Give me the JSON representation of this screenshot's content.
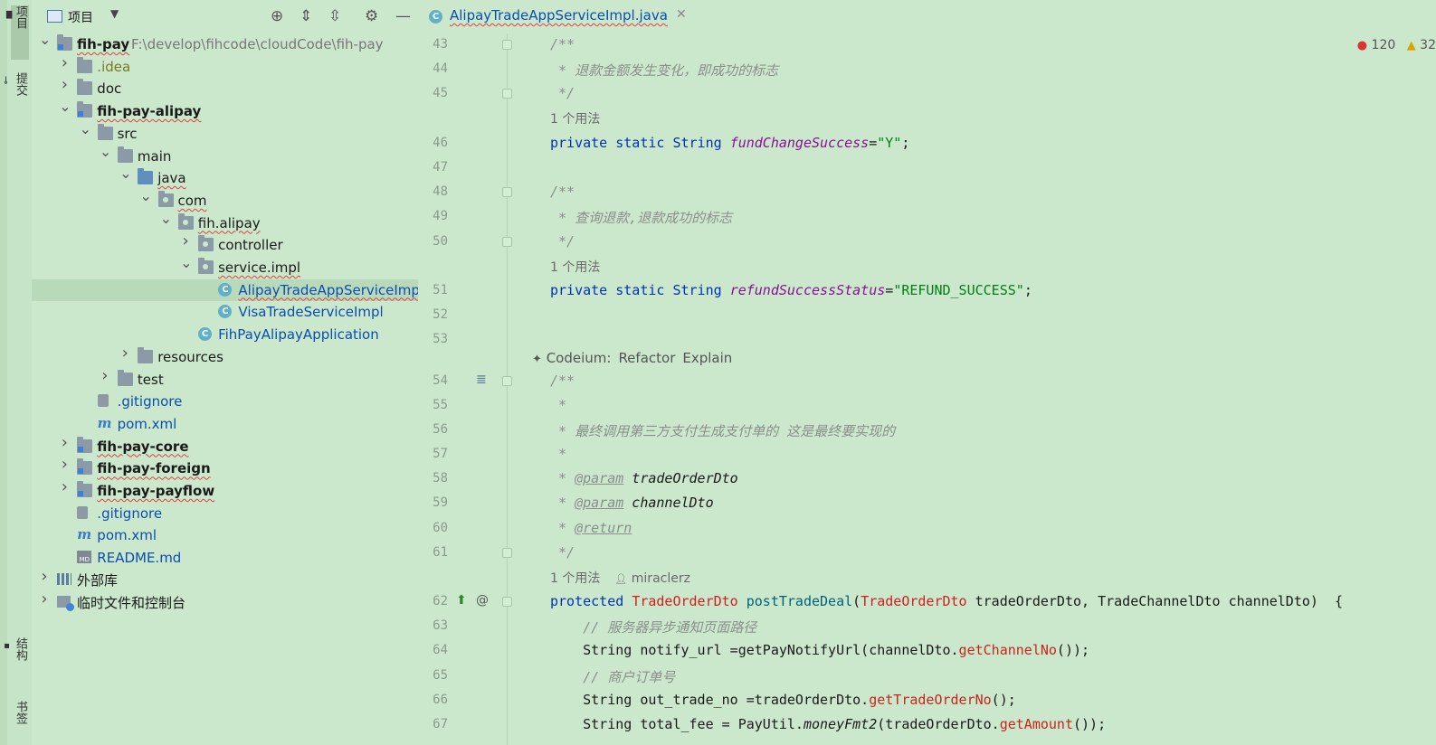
{
  "left_strip": {
    "tabs": [
      "项目",
      "提交",
      "结构",
      "书签"
    ]
  },
  "project_panel": {
    "title": "项目",
    "header_buttons": [
      "locate-icon",
      "expand-all-icon",
      "collapse-all-icon",
      "gear-icon",
      "minimize-icon"
    ],
    "root_path": "F:\\develop\\fihcode\\cloudCode\\fih-pay",
    "tree": [
      {
        "label": "fih-pay",
        "depth": 0,
        "arrow": "down",
        "icon": "module"
      },
      {
        "label": ".idea",
        "depth": 1,
        "arrow": "right",
        "icon": "folder"
      },
      {
        "label": "doc",
        "depth": 1,
        "arrow": "right",
        "icon": "folder"
      },
      {
        "label": "fih-pay-alipay",
        "depth": 1,
        "arrow": "down",
        "icon": "module"
      },
      {
        "label": "src",
        "depth": 2,
        "arrow": "down",
        "icon": "folder"
      },
      {
        "label": "main",
        "depth": 3,
        "arrow": "down",
        "icon": "folder"
      },
      {
        "label": "java",
        "depth": 4,
        "arrow": "down",
        "icon": "source-folder"
      },
      {
        "label": "com",
        "depth": 5,
        "arrow": "down",
        "icon": "package"
      },
      {
        "label": "fih.alipay",
        "depth": 6,
        "arrow": "down",
        "icon": "package"
      },
      {
        "label": "controller",
        "depth": 7,
        "arrow": "right",
        "icon": "package"
      },
      {
        "label": "service.impl",
        "depth": 7,
        "arrow": "down",
        "icon": "package"
      },
      {
        "label": "AlipayTradeAppServiceImp",
        "depth": 8,
        "arrow": "",
        "icon": "class"
      },
      {
        "label": "VisaTradeServiceImpl",
        "depth": 8,
        "arrow": "",
        "icon": "class"
      },
      {
        "label": "FihPayAlipayApplication",
        "depth": 7,
        "arrow": "",
        "icon": "class"
      },
      {
        "label": "resources",
        "depth": 4,
        "arrow": "right",
        "icon": "folder"
      },
      {
        "label": "test",
        "depth": 3,
        "arrow": "right",
        "icon": "folder"
      },
      {
        "label": ".gitignore",
        "depth": 2,
        "arrow": "",
        "icon": "gitignore"
      },
      {
        "label": "pom.xml",
        "depth": 2,
        "arrow": "",
        "icon": "maven"
      },
      {
        "label": "fih-pay-core",
        "depth": 1,
        "arrow": "right",
        "icon": "module"
      },
      {
        "label": "fih-pay-foreign",
        "depth": 1,
        "arrow": "right",
        "icon": "module"
      },
      {
        "label": "fih-pay-payflow",
        "depth": 1,
        "arrow": "right",
        "icon": "module"
      },
      {
        "label": ".gitignore",
        "depth": 1,
        "arrow": "",
        "icon": "gitignore"
      },
      {
        "label": "pom.xml",
        "depth": 1,
        "arrow": "",
        "icon": "maven"
      },
      {
        "label": "README.md",
        "depth": 1,
        "arrow": "",
        "icon": "markdown"
      },
      {
        "label": "外部库",
        "depth": 0,
        "arrow": "right",
        "icon": "library"
      },
      {
        "label": "临时文件和控制台",
        "depth": 0,
        "arrow": "right",
        "icon": "scratch"
      }
    ]
  },
  "editor": {
    "tab_label": "AlipayTradeAppServiceImpl.java",
    "tab_close": "✕",
    "errors": "120",
    "warnings": "32",
    "usage_hint": "1 个用法",
    "author": "miraclerz",
    "codeium": {
      "prefix": "Codeium:",
      "refactor": "Refactor",
      "explain": "Explain"
    },
    "lines": {
      "43": "/**",
      "44": " * 退款金额发生变化，即成功的标志",
      "45": " */",
      "46": [
        "private static String ",
        "fundChangeSuccess",
        "=",
        "\"Y\"",
        ";"
      ],
      "47": "",
      "48": "/**",
      "49": " * 查询退款,退款成功的标志",
      "50": " */",
      "51": [
        "private static String ",
        "refundSuccessStatus",
        "=",
        "\"REFUND_SUCCESS\"",
        ";"
      ],
      "52": "",
      "53": "",
      "54": "/**",
      "55": " *",
      "56": " * 最终调用第三方支付生成支付单的 这是最终要实现的",
      "57": " *",
      "58": [
        " * ",
        "@param",
        " tradeOrderDto"
      ],
      "59": [
        " * ",
        "@param",
        " channelDto"
      ],
      "60": [
        " * ",
        "@return"
      ],
      "61": " */",
      "62": [
        "protected ",
        "TradeOrderDto",
        " ",
        "postTradeDeal",
        "(",
        "TradeOrderDto",
        " tradeOrderDto, TradeChannelDto channelDto)  {"
      ],
      "63": "    // 服务器异步通知页面路径",
      "64": [
        "    String notify_url =getPayNotifyUrl(channelDto.",
        "getChannelNo",
        "());"
      ],
      "65": "    // 商户订单号",
      "66": [
        "    String out_trade_no =tradeOrderDto.",
        "getTradeOrderNo",
        "();"
      ],
      "67": [
        "    String total_fee = PayUtil.",
        "moneyFmt2",
        "(tradeOrderDto.",
        "getAmount",
        "());"
      ]
    }
  }
}
